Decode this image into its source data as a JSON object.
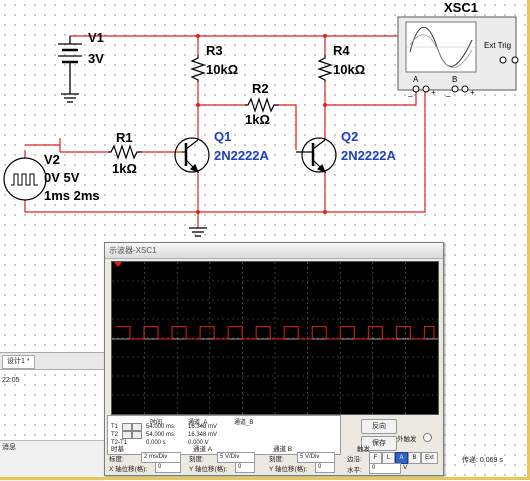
{
  "schematic": {
    "v1": {
      "name": "V1",
      "value": "3V"
    },
    "r3": {
      "name": "R3",
      "value": "10kΩ"
    },
    "r4": {
      "name": "R4",
      "value": "10kΩ"
    },
    "r2": {
      "name": "R2",
      "value": "1kΩ"
    },
    "r1": {
      "name": "R1",
      "value": "1kΩ"
    },
    "q1": {
      "name": "Q1",
      "model": "2N2222A"
    },
    "q2": {
      "name": "Q2",
      "model": "2N2222A"
    },
    "v2": {
      "name": "V2",
      "line1": "0V 5V",
      "line2": "1ms 2ms"
    },
    "xsc1": {
      "name": "XSC1",
      "ext_trig": "Ext Trig",
      "ch_a": "A",
      "ch_b": "B",
      "plus": "+",
      "minus": "_"
    }
  },
  "scope": {
    "title": "示波器-XSC1",
    "measurements": {
      "header": {
        "time": "时间",
        "ch_a": "通道_A",
        "ch_b": "通道_B"
      },
      "t1": {
        "label": "T1",
        "time": "54.000 ms",
        "ch_a": "16.348 mV",
        "ch_b": ""
      },
      "t2": {
        "label": "T2",
        "time": "54.000 ms",
        "ch_a": "16.348 mV",
        "ch_b": ""
      },
      "t2t1": {
        "label": "T2-T1",
        "time": "0.000 s",
        "ch_a": "0.000 V",
        "ch_b": ""
      }
    },
    "buttons": {
      "reverse": "反向",
      "save": "保存"
    },
    "ext_trigger": "外触发",
    "timebase": {
      "title": "时基",
      "scale_label": "标度:",
      "scale": "2 ms/Div",
      "xpos_label": "X 轴位移(格):",
      "xpos": "0"
    },
    "channel_a": {
      "title": "通道 A",
      "scale_label": "刻度:",
      "scale": "5 V/Div",
      "ypos_label": "Y 轴位移(格):",
      "ypos": "0"
    },
    "channel_b": {
      "title": "通道 B",
      "scale_label": "刻度:",
      "scale": "5 V/Div",
      "ypos_label": "Y 轴位移(格):",
      "ypos": "0"
    },
    "trigger": {
      "title": "触发",
      "edge_label": "边沿:",
      "level_label": "水平:",
      "level": "0",
      "unit": "V",
      "edges": [
        "F",
        "L",
        "A",
        "B",
        "Ext"
      ],
      "active_edge": "A"
    },
    "trace": {
      "color": "#e02020",
      "high_div": 0.5,
      "low_div": 0.0,
      "period_div": 1.0,
      "duty": 0.5
    }
  },
  "ui": {
    "tab_label": "设计1 *",
    "timestamp": "22:05",
    "bottom_label": "消息",
    "status": "传递: 0.069 s"
  },
  "colors": {
    "wire": "#e02020",
    "label_blue": "#1f3fbf",
    "trace": "#e02020",
    "screen": "#000000"
  }
}
